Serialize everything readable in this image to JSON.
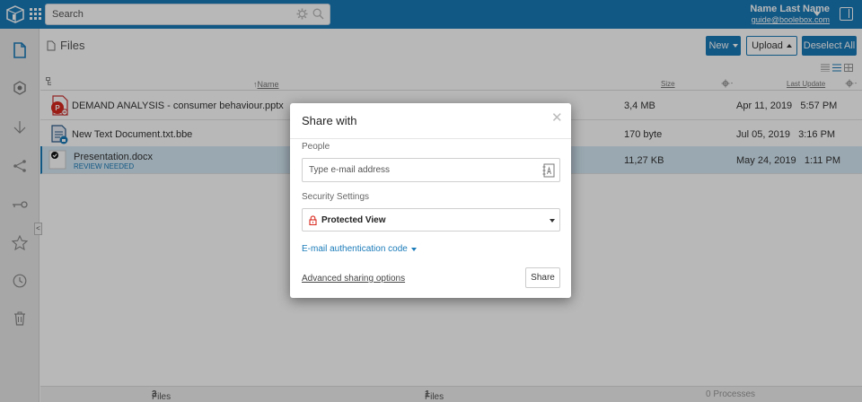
{
  "topbar": {
    "search_placeholder": "Search",
    "user_name": "Name Last Name",
    "user_email": "guide@boolebox.com"
  },
  "sidebar": {
    "items": [
      {
        "icon": "file-icon",
        "active": true
      },
      {
        "icon": "hexagon-icon"
      },
      {
        "icon": "download-icon"
      },
      {
        "icon": "share-icon"
      },
      {
        "icon": "key-icon"
      },
      {
        "icon": "star-icon"
      },
      {
        "icon": "clock-icon"
      },
      {
        "icon": "trash-icon"
      }
    ]
  },
  "main": {
    "breadcrumb": "Files",
    "toolbar": {
      "new_label": "New",
      "upload_label": "Upload",
      "deselect_label": "Deselect All"
    },
    "columns": {
      "name": "Name",
      "size": "Size",
      "last_update": "Last Update"
    },
    "files": [
      {
        "name": "DEMAND ANALYSIS - consumer behaviour.pptx",
        "size": "3,4 MB",
        "date": "Apr 11, 2019",
        "time": "5:57 PM",
        "icon": "pptx-icon"
      },
      {
        "name": "New Text Document.txt.bbe",
        "size": "170 byte",
        "date": "Jul 05, 2019",
        "time": "3:16 PM",
        "icon": "encrypted-doc-icon"
      },
      {
        "name": "Presentation.docx",
        "status": "REVIEW NEEDED",
        "size": "11,27 KB",
        "date": "May 24, 2019",
        "time": "1:11 PM",
        "icon": "doc-icon",
        "selected": true
      }
    ]
  },
  "footer": {
    "files_loaded_label": "Files loaded",
    "files_loaded_count": "3",
    "files_selected_label": "Files selected",
    "files_selected_count": "1",
    "processes": "0 Processes"
  },
  "modal": {
    "title": "Share with",
    "people_label": "People",
    "email_placeholder": "Type e-mail address",
    "security_label": "Security Settings",
    "security_value": "Protected View",
    "auth_link": "E-mail authentication code",
    "advanced_link": "Advanced sharing options",
    "share_button": "Share"
  },
  "colors": {
    "brand": "#1a7bb9",
    "selected_row": "#d6e9f5",
    "danger": "#d9291f"
  }
}
